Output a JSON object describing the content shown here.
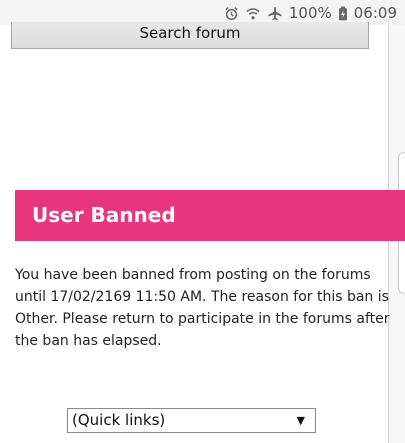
{
  "status_bar": {
    "battery_percent": "100%",
    "time": "06:09",
    "icons": [
      "alarm-icon",
      "wifi-icon",
      "airplane-mode-icon",
      "battery-icon"
    ]
  },
  "forum": {
    "search_button_label": "Search forum"
  },
  "notice": {
    "title": "User Banned",
    "message": "You have been banned from posting on the forums until 17/02/2169 11:50 AM. The reason for this ban is Other. Please return to participate in the forums after the ban has elapsed."
  },
  "quick_links": {
    "selected": "(Quick links)",
    "arrow": "▼"
  },
  "colors": {
    "banner": "#e8357e",
    "banner_text": "#ffffff",
    "body_text": "#222222"
  }
}
